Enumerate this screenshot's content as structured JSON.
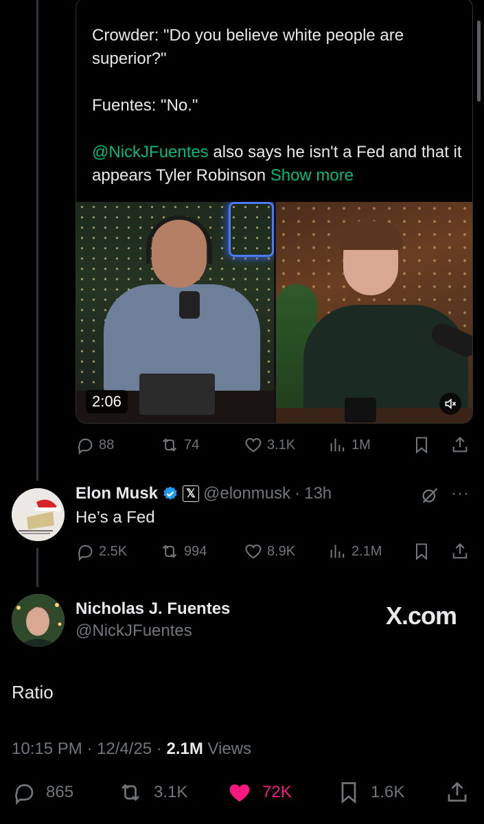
{
  "quote": {
    "line1": "Crowder: \"Do you believe white people are superior?\"",
    "line2": "Fuentes: \"No.\"",
    "mention": "@NickJFuentes",
    "line3_rest": " also says he isn't a Fed and that it appears Tyler Robinson ",
    "show_more": "Show more",
    "video_duration": "2:06"
  },
  "quote_actions": {
    "replies": "88",
    "reposts": "74",
    "likes": "3.1K",
    "views": "1M"
  },
  "reply": {
    "name": "Elon Musk",
    "handle": "@elonmusk",
    "separator": "·",
    "time": "13h",
    "text": "He’s a Fed",
    "replies": "2.5K",
    "reposts": "994",
    "likes": "8.9K",
    "views": "2.1M"
  },
  "main_post": {
    "name": "Nicholas J. Fuentes",
    "handle": "@NickJFuentes",
    "watermark": "X.com",
    "text": "Ratio",
    "time": "10:15 PM",
    "dot1": " · ",
    "date": "12/4/25",
    "dot2": " · ",
    "views_count": "2.1M",
    "views_label": " Views",
    "replies": "865",
    "reposts": "3.1K",
    "likes": "72K",
    "bookmarks": "1.6K"
  },
  "colors": {
    "background": "#000000",
    "text": "#e7e9ea",
    "muted": "#71767b",
    "link": "#1d9bf0",
    "show_more": "#00ba7c",
    "like_active": "#f91880",
    "verified": "#1d9bf0"
  }
}
